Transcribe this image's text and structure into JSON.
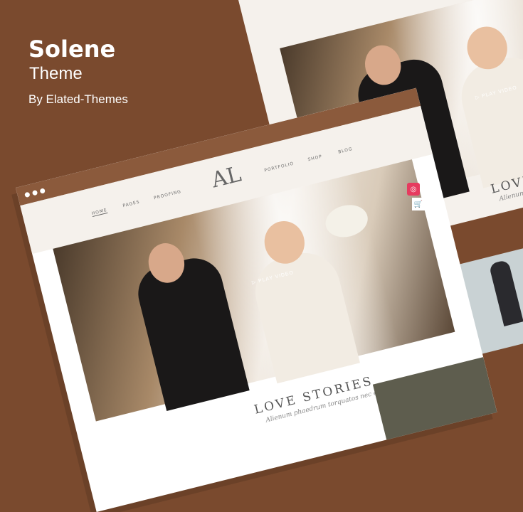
{
  "brand": {
    "title": "Solene",
    "subtitle": "Theme",
    "by": "By Elated-Themes"
  },
  "nav": {
    "home": "HOME",
    "pages": "PAGES",
    "proofing": "PROOFING",
    "portfolio": "PORTFOLIO",
    "shop": "SHOP",
    "blog": "BLOG"
  },
  "logo": "AL",
  "hero": {
    "play": "▷ PLAY VIDEO"
  },
  "section": {
    "title": "LOVE STORIES",
    "subtitle": "Alienum phaedrum torquatos nec eu"
  },
  "back_window": {
    "play": "▷ PLAY VIDEO",
    "section_title": "LOVE STORIES",
    "section_subtitle": "Alienum phaedrum torquatos nec eu"
  }
}
